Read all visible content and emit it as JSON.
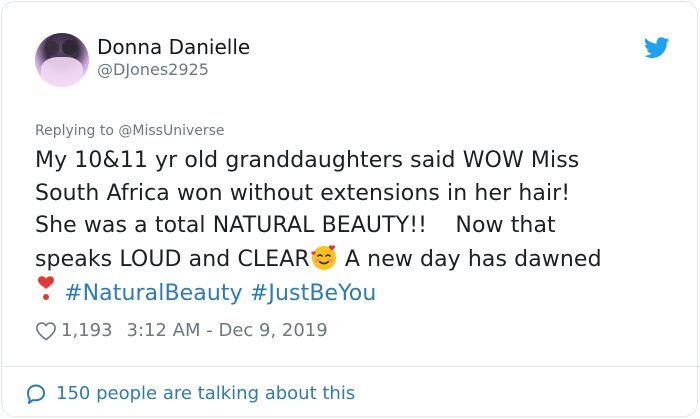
{
  "author": {
    "name": "Donna Danielle",
    "handle": "@DJones2925"
  },
  "reply": {
    "prefix": "Replying to ",
    "to": "@MissUniverse"
  },
  "tweet": {
    "line1": "My 10&11 yr old granddaughters said WOW Miss",
    "line2": "South Africa won without extensions in her hair!",
    "line3": "She was a total NATURAL BEAUTY!!    Now that",
    "line4_text": "speaks LOUD and CLEAR",
    "line4_emoji": "smiling-face-with-hearts",
    "line4_after": " A new day has dawned",
    "line5_emoji": "heavy-heart-exclamation",
    "hashtags": [
      "#NaturalBeauty",
      "#JustBeYou"
    ]
  },
  "meta": {
    "likes": "1,193",
    "time": "3:12 AM - Dec 9, 2019"
  },
  "footer": {
    "talking": "150 people are talking about this"
  },
  "colors": {
    "link": "#2b7bb9",
    "muted": "#697882",
    "twitter_blue": "#1da1f2"
  },
  "icons": [
    "twitter-bird-icon",
    "heart-icon",
    "comment-bubble-icon"
  ]
}
